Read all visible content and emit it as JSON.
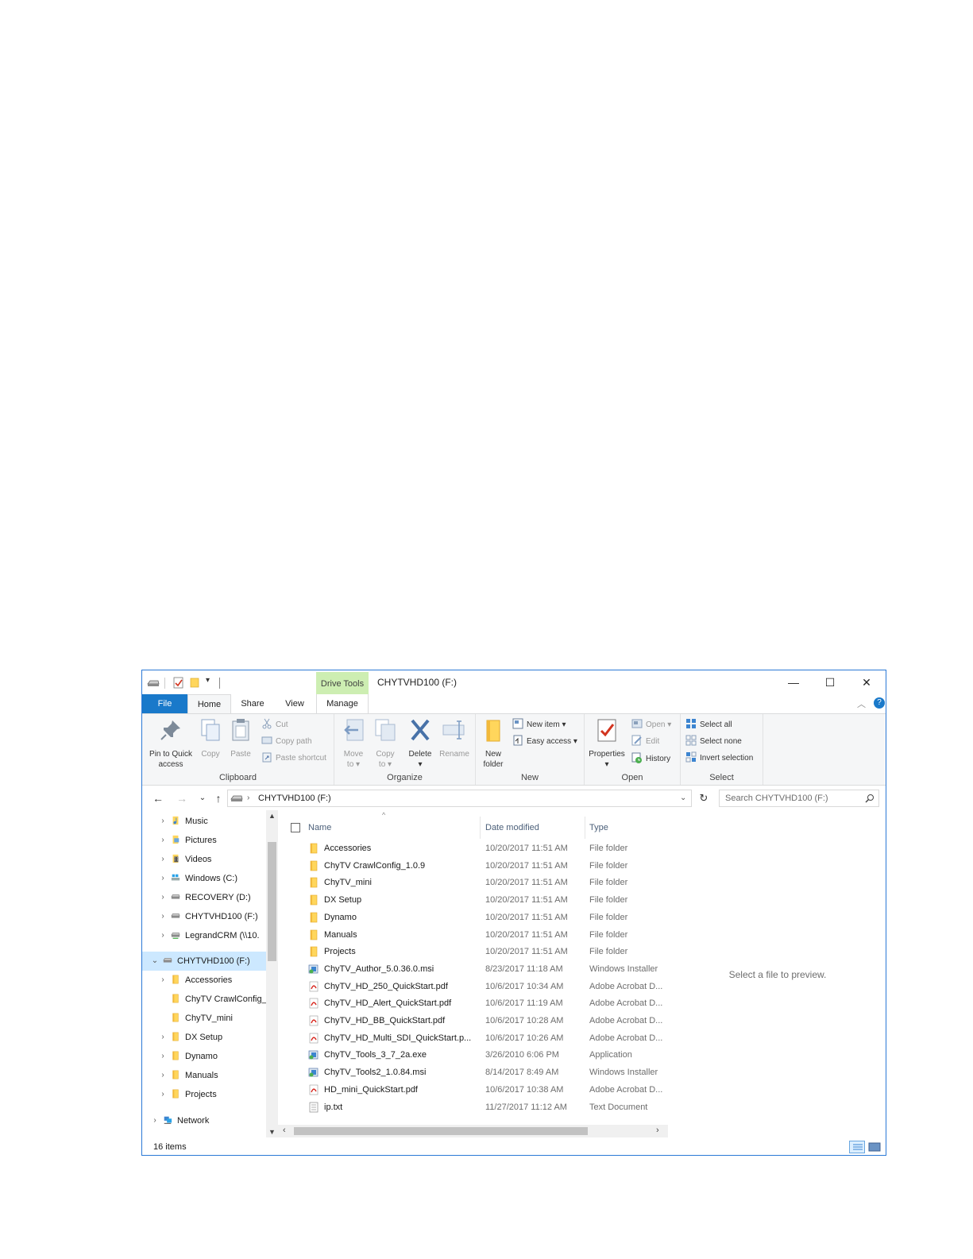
{
  "titlebar": {
    "contextual_tab": "Drive Tools",
    "title": "CHYTVHD100 (F:)",
    "minimize": "—",
    "maximize": "☐",
    "close": "✕"
  },
  "tabs": {
    "file": "File",
    "home": "Home",
    "share": "Share",
    "view": "View",
    "manage": "Manage"
  },
  "ribbon": {
    "clipboard": {
      "label": "Clipboard",
      "pin_line1": "Pin to Quick",
      "pin_line2": "access",
      "copy": "Copy",
      "paste": "Paste",
      "cut": "Cut",
      "copy_path": "Copy path",
      "paste_shortcut": "Paste shortcut"
    },
    "organize": {
      "label": "Organize",
      "move_line1": "Move",
      "move_line2": "to ▾",
      "copy_line1": "Copy",
      "copy_line2": "to ▾",
      "delete": "Delete",
      "delete_arrow": "▾",
      "rename": "Rename"
    },
    "new": {
      "label": "New",
      "new_folder_line1": "New",
      "new_folder_line2": "folder",
      "new_item": "New item ▾",
      "easy_access": "Easy access ▾"
    },
    "open": {
      "label": "Open",
      "properties": "Properties",
      "properties_arrow": "▾",
      "open": "Open ▾",
      "edit": "Edit",
      "history": "History"
    },
    "select": {
      "label": "Select",
      "select_all": "Select all",
      "select_none": "Select none",
      "invert": "Invert selection"
    }
  },
  "address": {
    "path": "CHYTVHD100 (F:)",
    "search_placeholder": "Search CHYTVHD100 (F:)"
  },
  "nav": {
    "items": [
      {
        "label": "Music",
        "chevron": "›",
        "icon": "music-icon"
      },
      {
        "label": "Pictures",
        "chevron": "›",
        "icon": "pictures-icon"
      },
      {
        "label": "Videos",
        "chevron": "›",
        "icon": "videos-icon"
      },
      {
        "label": "Windows (C:)",
        "chevron": "›",
        "icon": "windows-drive-icon"
      },
      {
        "label": "RECOVERY (D:)",
        "chevron": "›",
        "icon": "drive-icon"
      },
      {
        "label": "CHYTVHD100 (F:)",
        "chevron": "›",
        "icon": "drive-icon"
      },
      {
        "label": "LegrandCRM (\\\\10.",
        "chevron": "›",
        "icon": "network-drive-icon"
      },
      {
        "label": "CHYTVHD100 (F:)",
        "chevron": "⌄",
        "icon": "drive-icon"
      },
      {
        "label": "Accessories",
        "chevron": "›",
        "icon": "folder-icon"
      },
      {
        "label": "ChyTV CrawlConfig_",
        "chevron": "",
        "icon": "folder-icon"
      },
      {
        "label": "ChyTV_mini",
        "chevron": "",
        "icon": "folder-icon"
      },
      {
        "label": "DX Setup",
        "chevron": "›",
        "icon": "folder-icon"
      },
      {
        "label": "Dynamo",
        "chevron": "›",
        "icon": "folder-icon"
      },
      {
        "label": "Manuals",
        "chevron": "›",
        "icon": "folder-icon"
      },
      {
        "label": "Projects",
        "chevron": "›",
        "icon": "folder-icon"
      },
      {
        "label": "Network",
        "chevron": "›",
        "icon": "network-icon"
      }
    ]
  },
  "list": {
    "columns": {
      "name": "Name",
      "date": "Date modified",
      "type": "Type"
    },
    "sort_indicator": "^",
    "rows": [
      {
        "name": "Accessories",
        "date": "10/20/2017 11:51 AM",
        "type": "File folder",
        "icon": "folder-icon"
      },
      {
        "name": "ChyTV CrawlConfig_1.0.9",
        "date": "10/20/2017 11:51 AM",
        "type": "File folder",
        "icon": "folder-icon"
      },
      {
        "name": "ChyTV_mini",
        "date": "10/20/2017 11:51 AM",
        "type": "File folder",
        "icon": "folder-icon"
      },
      {
        "name": "DX Setup",
        "date": "10/20/2017 11:51 AM",
        "type": "File folder",
        "icon": "folder-icon"
      },
      {
        "name": "Dynamo",
        "date": "10/20/2017 11:51 AM",
        "type": "File folder",
        "icon": "folder-icon"
      },
      {
        "name": "Manuals",
        "date": "10/20/2017 11:51 AM",
        "type": "File folder",
        "icon": "folder-icon"
      },
      {
        "name": "Projects",
        "date": "10/20/2017 11:51 AM",
        "type": "File folder",
        "icon": "folder-icon"
      },
      {
        "name": "ChyTV_Author_5.0.36.0.msi",
        "date": "8/23/2017 11:18 AM",
        "type": "Windows Installer",
        "icon": "installer-icon"
      },
      {
        "name": "ChyTV_HD_250_QuickStart.pdf",
        "date": "10/6/2017 10:34 AM",
        "type": "Adobe Acrobat D...",
        "icon": "pdf-icon"
      },
      {
        "name": "ChyTV_HD_Alert_QuickStart.pdf",
        "date": "10/6/2017 11:19 AM",
        "type": "Adobe Acrobat D...",
        "icon": "pdf-icon"
      },
      {
        "name": "ChyTV_HD_BB_QuickStart.pdf",
        "date": "10/6/2017 10:28 AM",
        "type": "Adobe Acrobat D...",
        "icon": "pdf-icon"
      },
      {
        "name": "ChyTV_HD_Multi_SDI_QuickStart.p...",
        "date": "10/6/2017 10:26 AM",
        "type": "Adobe Acrobat D...",
        "icon": "pdf-icon"
      },
      {
        "name": "ChyTV_Tools_3_7_2a.exe",
        "date": "3/26/2010 6:06 PM",
        "type": "Application",
        "icon": "installer-icon"
      },
      {
        "name": "ChyTV_Tools2_1.0.84.msi",
        "date": "8/14/2017 8:49 AM",
        "type": "Windows Installer",
        "icon": "installer-icon"
      },
      {
        "name": "HD_mini_QuickStart.pdf",
        "date": "10/6/2017 10:38 AM",
        "type": "Adobe Acrobat D...",
        "icon": "pdf-icon"
      },
      {
        "name": "ip.txt",
        "date": "11/27/2017 11:12 AM",
        "type": "Text Document",
        "icon": "text-file-icon"
      }
    ]
  },
  "preview": {
    "text": "Select a file to preview."
  },
  "status": {
    "items": "16 items"
  },
  "colors": {
    "accent": "#1979ca",
    "selection": "#cce8ff",
    "drive_tools": "#cdeeb2",
    "folder": "#ffd65c",
    "pdf": "#d7261e"
  }
}
